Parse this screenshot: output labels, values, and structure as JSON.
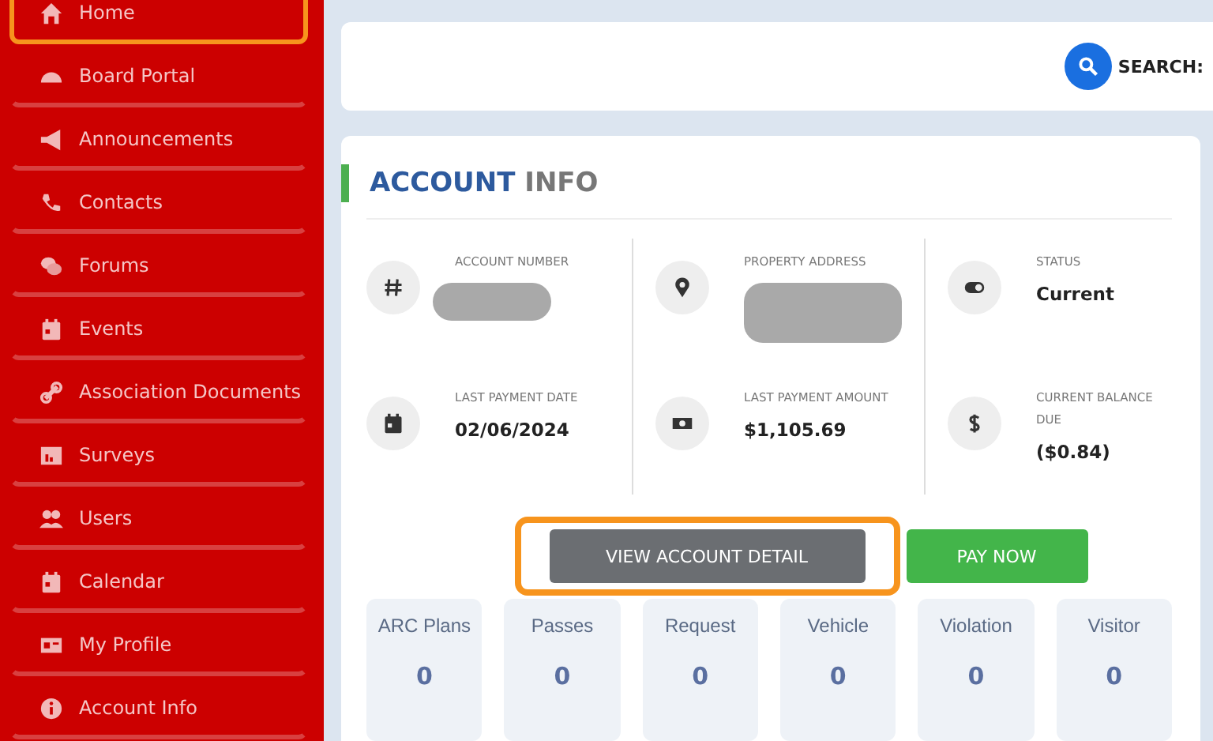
{
  "sidebar": {
    "items": [
      {
        "label": "Home",
        "highlighted": true
      },
      {
        "label": "Board Portal",
        "highlighted": false
      },
      {
        "label": "Announcements",
        "highlighted": false
      },
      {
        "label": "Contacts",
        "highlighted": false
      },
      {
        "label": "Forums",
        "highlighted": false
      },
      {
        "label": "Events",
        "highlighted": false
      },
      {
        "label": "Association Documents",
        "highlighted": false
      },
      {
        "label": "Surveys",
        "highlighted": false
      },
      {
        "label": "Users",
        "highlighted": false
      },
      {
        "label": "Calendar",
        "highlighted": false
      },
      {
        "label": "My Profile",
        "highlighted": false
      },
      {
        "label": "Account Info",
        "highlighted": false
      }
    ]
  },
  "search": {
    "label": "SEARCH:"
  },
  "account": {
    "title_bold": "ACCOUNT",
    "title_rest": "INFO",
    "fields": [
      {
        "label": "ACCOUNT NUMBER",
        "redacted": true
      },
      {
        "label": "PROPERTY ADDRESS",
        "redacted": true
      },
      {
        "label": "STATUS",
        "value": "Current",
        "redacted": false
      },
      {
        "label": "LAST PAYMENT DATE",
        "value": "02/06/2024",
        "redacted": false
      },
      {
        "label": "LAST PAYMENT AMOUNT",
        "value": "$1,105.69",
        "redacted": false
      },
      {
        "label": "CURRENT BALANCE DUE",
        "value": "($0.84)",
        "redacted": false
      }
    ],
    "buttons": [
      {
        "label": "VIEW ACCOUNT DETAIL",
        "kind": "secondary",
        "highlighted": true
      },
      {
        "label": "PAY NOW",
        "kind": "primary",
        "highlighted": false
      }
    ],
    "tiles": [
      {
        "label": "ARC Plans",
        "count": "0"
      },
      {
        "label": "Passes",
        "count": "0"
      },
      {
        "label": "Request",
        "count": "0"
      },
      {
        "label": "Vehicle",
        "count": "0"
      },
      {
        "label": "Violation",
        "count": "0"
      },
      {
        "label": "Visitor",
        "count": "0"
      }
    ]
  }
}
